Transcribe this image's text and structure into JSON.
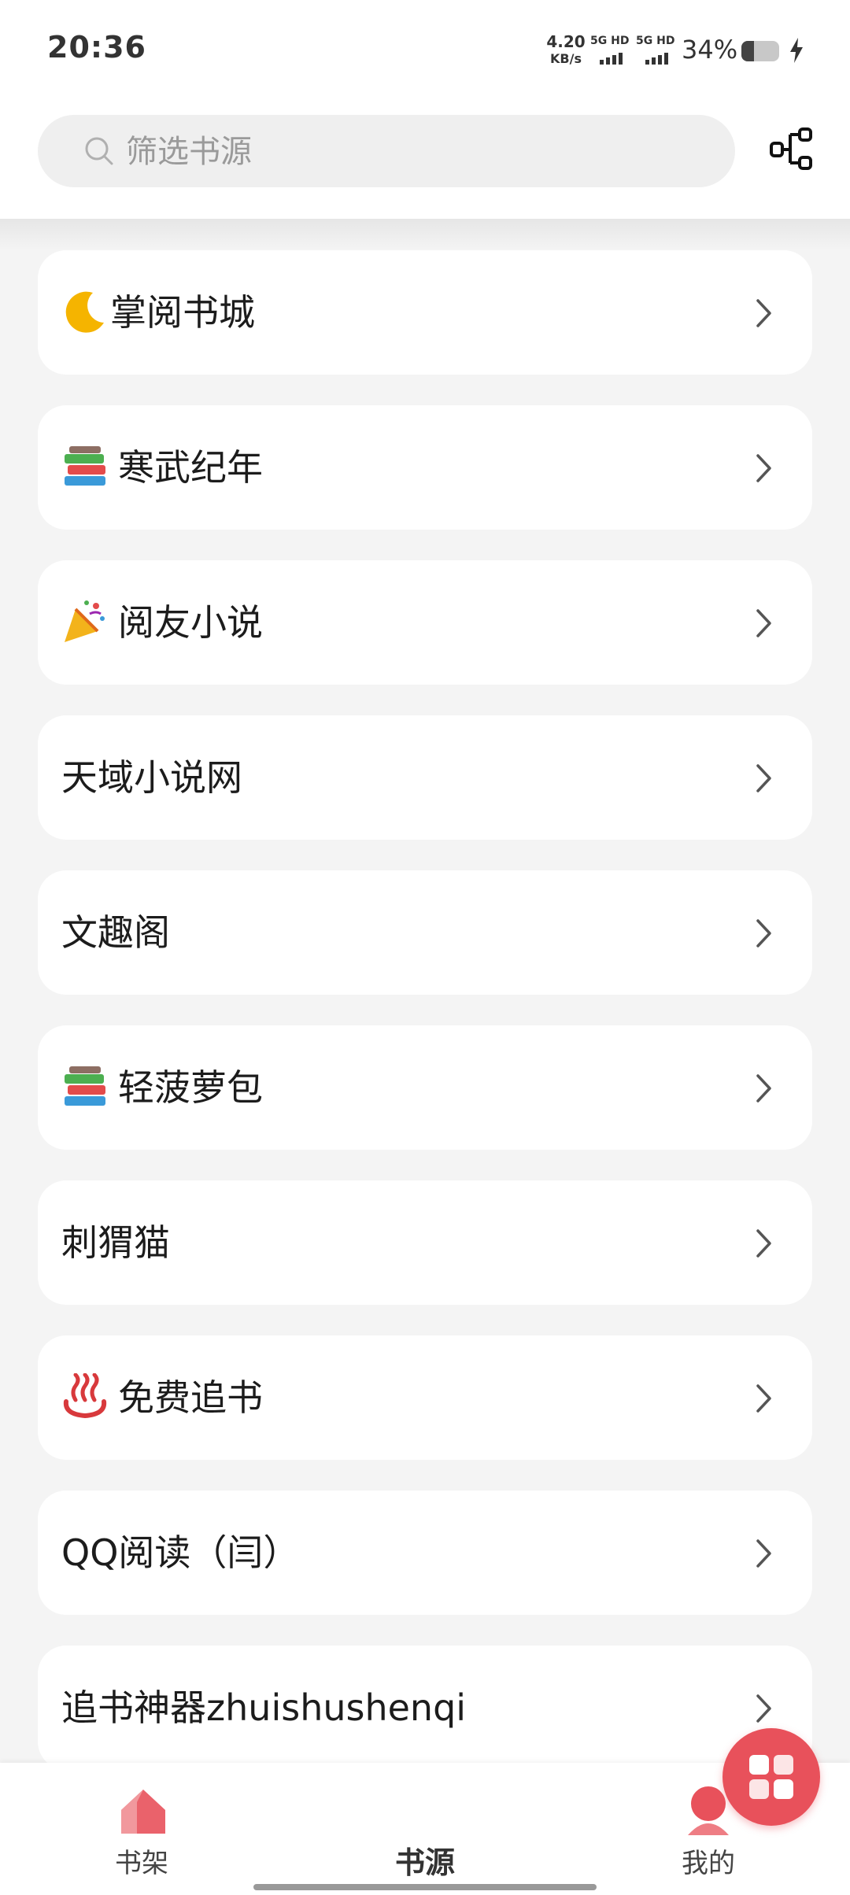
{
  "status_bar": {
    "time": "20:36",
    "network_speed_value": "4.20",
    "network_speed_unit": "KB/s",
    "sim1_label": "5G HD",
    "sim2_label": "5G HD",
    "battery_percent": "34%",
    "battery_level": 0.34
  },
  "search": {
    "placeholder": "筛选书源"
  },
  "sources": [
    {
      "emoji": "crescent-moon",
      "name": "掌阅书城"
    },
    {
      "emoji": "books",
      "name": "寒武纪年"
    },
    {
      "emoji": "party-popper",
      "name": "阅友小说"
    },
    {
      "emoji": "",
      "name": "天域小说网"
    },
    {
      "emoji": "",
      "name": "文趣阁"
    },
    {
      "emoji": "books",
      "name": "轻菠萝包"
    },
    {
      "emoji": "",
      "name": "刺猬猫"
    },
    {
      "emoji": "hot-springs",
      "name": "免费追书"
    },
    {
      "emoji": "",
      "name": "QQ阅读（闫）"
    },
    {
      "emoji": "",
      "name": "追书神器zhuishushenqi"
    }
  ],
  "bottom_nav": {
    "items": [
      {
        "label": "书架",
        "icon": "bookshelf-house-icon"
      },
      {
        "label": "书源",
        "icon": "sources-grid-icon"
      },
      {
        "label": "我的",
        "icon": "profile-icon"
      }
    ],
    "active": "书源"
  },
  "colors": {
    "accent": "#e8515b",
    "background": "#f4f4f4",
    "card": "#ffffff"
  }
}
